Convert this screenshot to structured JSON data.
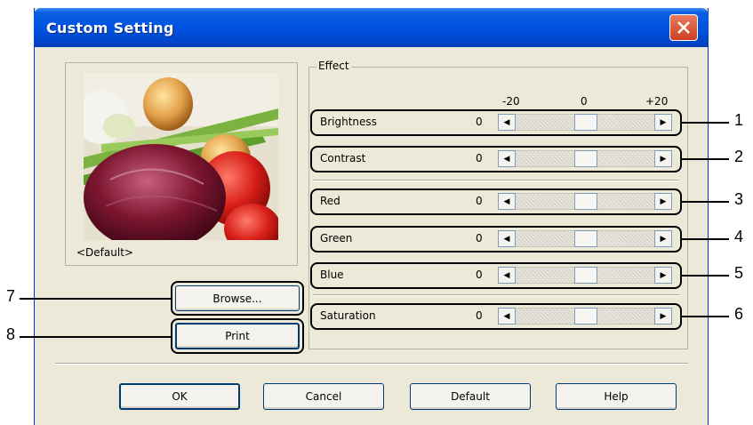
{
  "window": {
    "title": "Custom Setting"
  },
  "preview": {
    "caption": "<Default>"
  },
  "side_buttons": {
    "browse": "Browse...",
    "print": "Print"
  },
  "effect": {
    "group_label": "Effect",
    "scale": {
      "min": "-20",
      "mid": "0",
      "max": "+20"
    },
    "rows": [
      {
        "label": "Brightness",
        "value": "0"
      },
      {
        "label": "Contrast",
        "value": "0"
      },
      {
        "label": "Red",
        "value": "0"
      },
      {
        "label": "Green",
        "value": "0"
      },
      {
        "label": "Blue",
        "value": "0"
      },
      {
        "label": "Saturation",
        "value": "0"
      }
    ]
  },
  "footer": {
    "ok": "OK",
    "cancel": "Cancel",
    "default": "Default",
    "help": "Help"
  },
  "callouts": [
    "1",
    "2",
    "3",
    "4",
    "5",
    "6",
    "7",
    "8"
  ],
  "colors": {
    "titlebar": "#0054e3",
    "dialog_bg": "#ece9d8",
    "close_button": "#e0502e"
  }
}
